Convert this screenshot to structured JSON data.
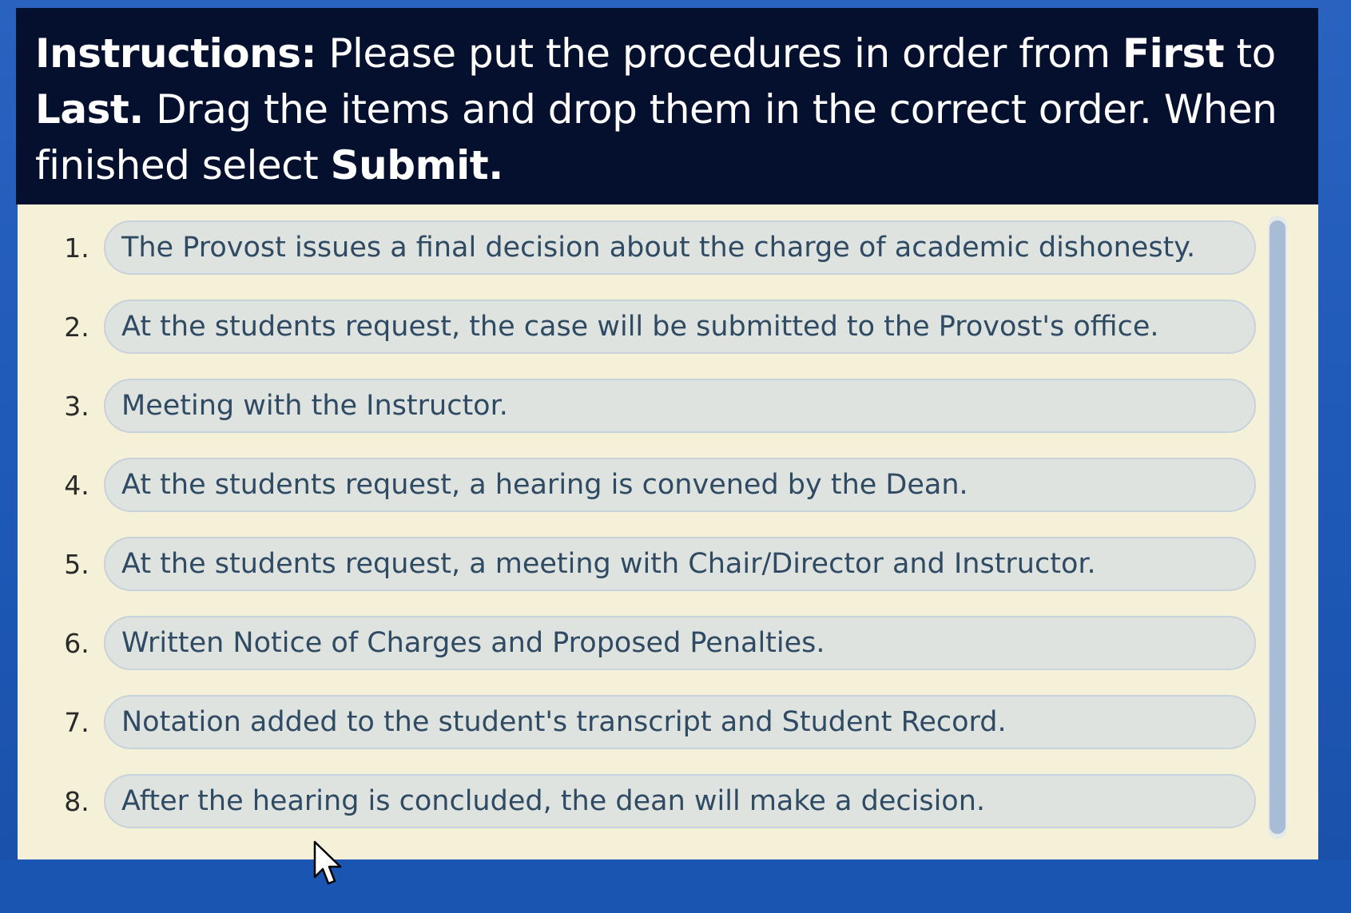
{
  "instructions": {
    "p1": "Instructions:",
    "p2": " Please put the procedures in order from ",
    "p3": "First",
    "p4": " to ",
    "p5": "Last.",
    "p6": " Drag the items and drop them in the correct order. When finished select ",
    "p7": "Submit."
  },
  "items": [
    {
      "number": "1.",
      "text": "The Provost issues a final decision about the charge of academic dishonesty."
    },
    {
      "number": "2.",
      "text": "At the students request, the case will be submitted to the Provost's office."
    },
    {
      "number": "3.",
      "text": "Meeting with the Instructor."
    },
    {
      "number": "4.",
      "text": "At the students request, a hearing is convened by the Dean."
    },
    {
      "number": "5.",
      "text": "At the students request, a meeting with Chair/Director and Instructor."
    },
    {
      "number": "6.",
      "text": "Written Notice of Charges and Proposed Penalties."
    },
    {
      "number": "7.",
      "text": "Notation added to the student's transcript and Student Record."
    },
    {
      "number": "8.",
      "text": "After the hearing is concluded, the dean will make a decision."
    }
  ],
  "colors": {
    "header_bg": "#05102e",
    "panel_bg": "#f4f1d8",
    "frame_bg": "#1b56b4",
    "pill_bg": "#dfe3e0",
    "pill_text": "#2f4a63"
  },
  "icons": {
    "cursor": "arrow-cursor-icon"
  }
}
